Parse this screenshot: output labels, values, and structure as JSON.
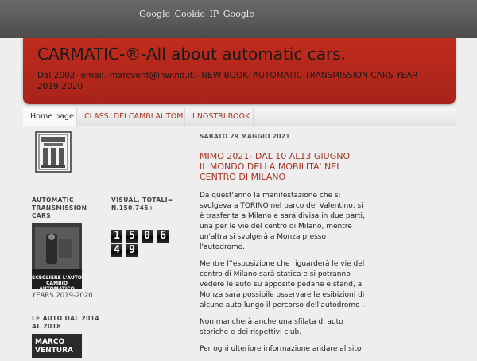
{
  "cookie_bar": {
    "text": "Google Cookie IP Google"
  },
  "header": {
    "title": "CARMATIC-®-All about automatic cars.",
    "description": "Dal 2002- email.-marcvent@inwind.it.- NEW BOOK- AUTOMATIC TRANSMISSION CARS YEAR 2019-2020"
  },
  "tabs": [
    {
      "label": "Home page"
    },
    {
      "label": "CLASS. DEI CAMBI AUTOM."
    },
    {
      "label": "I NOSTRI BOOK"
    }
  ],
  "sidebar": {
    "widget1": {
      "title": "AUTOMATIC TRANSMISSION CARS",
      "book_cover_text": "SCEGLIERE L'AUTO CAMBIO AUTOMATICO",
      "caption": "YEARS 2019-2020"
    },
    "widget2": {
      "title": "LE AUTO DAL 2014 AL 2018",
      "book_cover_text": "MARCO VENTURA"
    },
    "counter": {
      "title": "VISUAL. TOTALI= N.150.746+",
      "digits": [
        "1",
        "5",
        "0",
        "6",
        "4",
        "9"
      ]
    }
  },
  "post": {
    "date": "SABATO 29 MAGGIO 2021",
    "title": "MIMO 2021- DAL 10 AL13 GIUGNO IL MONDO DELLA MOBILITA' NEL CENTRO DI MILANO",
    "paragraphs": [
      "Da quest'anno la manifestazione che si svolgeva a TORINO  nel parco del Valentino, si è trasferita a Milano e sarà divisa in due parti, una per le vie del centro di Milano, mentre un'altra si svolgerà a Monza presso l'autodromo.",
      "Mentre l''esposizione  che riguarderà le vie del centro di Milano sarà statica e si potranno vedere le auto su apposite pedane e stand, a Monza  sarà possibile osservare le esibizioni di alcune auto lungo il percorso dell'autodromo .",
      "Non mancherà anche una sfilata di auto storiche e dei rispettivi club.",
      "Per ogni ulteriore informazione andare al sito"
    ]
  },
  "colors": {
    "header_red": "#b5291c",
    "link_red": "#a8321f",
    "topbar_gray": "#5a5a5a",
    "page_bg": "#eeeeee"
  }
}
